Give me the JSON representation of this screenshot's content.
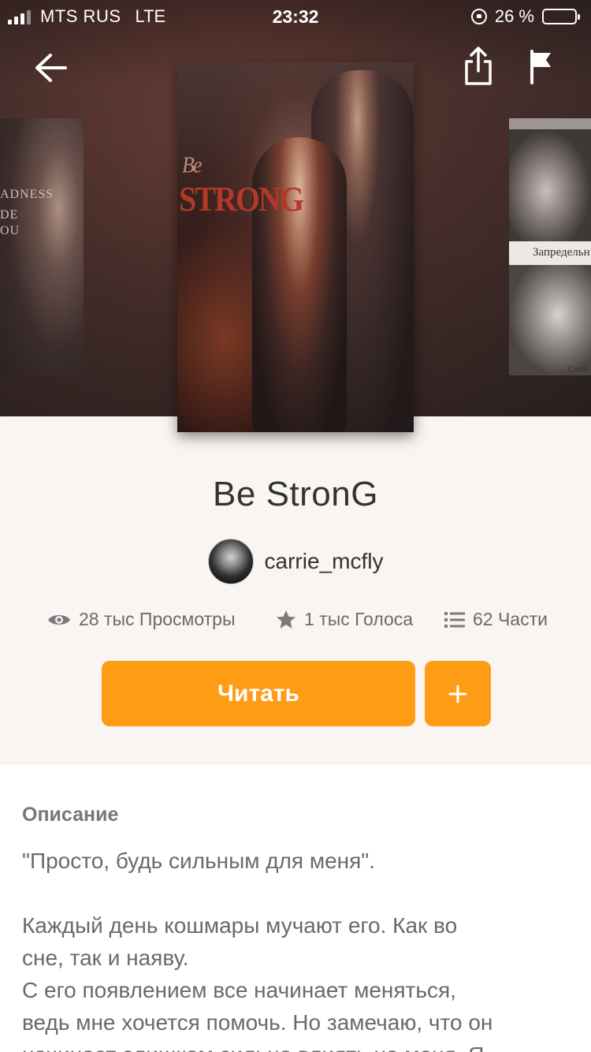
{
  "status_bar": {
    "carrier": "MTS RUS",
    "network": "LTE",
    "time": "23:32",
    "battery_text": "26 %",
    "battery_level": 0.26
  },
  "covers": {
    "left_cover_text": [
      "ADNESS",
      "DE",
      "OU"
    ],
    "right_cover_text": "Запредельн",
    "right_cover_signature": "Carrie",
    "main_cover_text": [
      "Be",
      "STRONG"
    ]
  },
  "book": {
    "title": "Be StronG",
    "author": "carrie_mcfly"
  },
  "stats": {
    "views": "28 тыс Просмотры",
    "votes": "1 тыс Голоса",
    "parts": "62 Части"
  },
  "actions": {
    "read_label": "Читать",
    "add_label": "+"
  },
  "description": {
    "heading": "Описание",
    "quote": "\"Просто, будь сильным для меня\".",
    "line1": "Каждый день кошмары мучают его. Как во",
    "line2": "сне, так и наяву.",
    "line3": "С его появлением все начинает меняться,",
    "line4": "ведь мне хочется помочь. Но замечаю, что он",
    "line5": "начинает слишком сильно влиять на меня. Я"
  },
  "colors": {
    "accent": "#ff9c16",
    "background": "#f8f5f2"
  }
}
